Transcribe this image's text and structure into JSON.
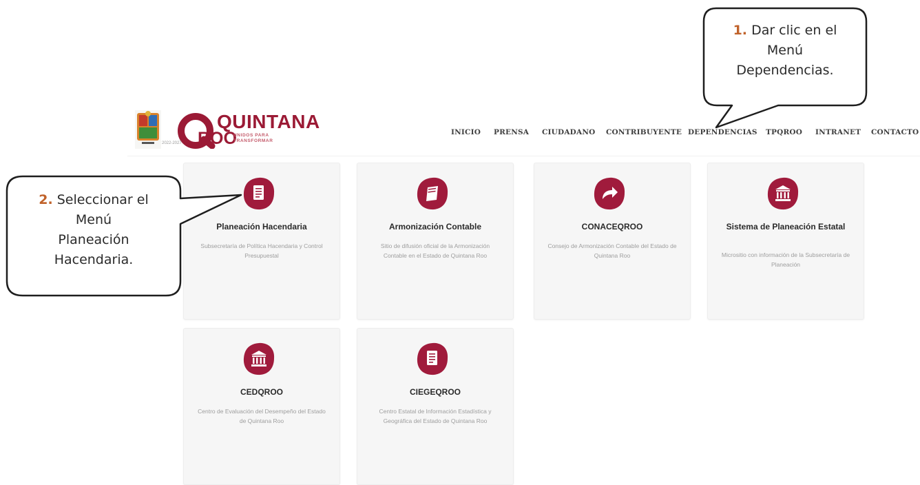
{
  "brand": {
    "line1": "QUINTANA",
    "line2": "ROO",
    "tagline": "UNIDOS PARA TRANSFORMAR",
    "years": "2022-2027",
    "accent": "#9b1a35"
  },
  "nav": {
    "items": [
      "INICIO",
      "PRENSA",
      "CIUDADANO",
      "CONTRIBUYENTE",
      "DEPENDENCIAS",
      "TPQROO",
      "INTRANET",
      "CONTACTO"
    ]
  },
  "cards": [
    {
      "title": "Planeación Hacendaria",
      "description": "Subsecretaría de Política Hacendaria y Control Presupuestal",
      "icon": "document-icon"
    },
    {
      "title": "Armonización Contable",
      "description": "Sitio de difusión oficial de la Armonización Contable en el Estado de Quintana Roo",
      "icon": "book-icon"
    },
    {
      "title": "CONACEQROO",
      "description": "Consejo de Armonización Contable del Estado de Quintana Roo",
      "icon": "share-arrow-icon"
    },
    {
      "title": "Sistema de Planeación Estatal",
      "description": "Micrositio con información de la Subsecretaría de Planeación",
      "icon": "institution-icon"
    },
    {
      "title": "CEDQROO",
      "description": "Centro de Evaluación del Desempeño del Estado de Quintana Roo",
      "icon": "institution-icon"
    },
    {
      "title": "CIEGEQROO",
      "description": "Centro Estatal de Información Estadística y Geográfica del Estado de Quintana Roo",
      "icon": "document-icon"
    }
  ],
  "callouts": {
    "step1": {
      "number": "1.",
      "text_a": "Dar clic en el",
      "text_b": "Menú",
      "text_c": "Dependencias."
    },
    "step2": {
      "number": "2.",
      "text_a": "Seleccionar el",
      "text_b": "Menú",
      "text_c": "Planeación",
      "text_d": "Hacendaria."
    }
  }
}
